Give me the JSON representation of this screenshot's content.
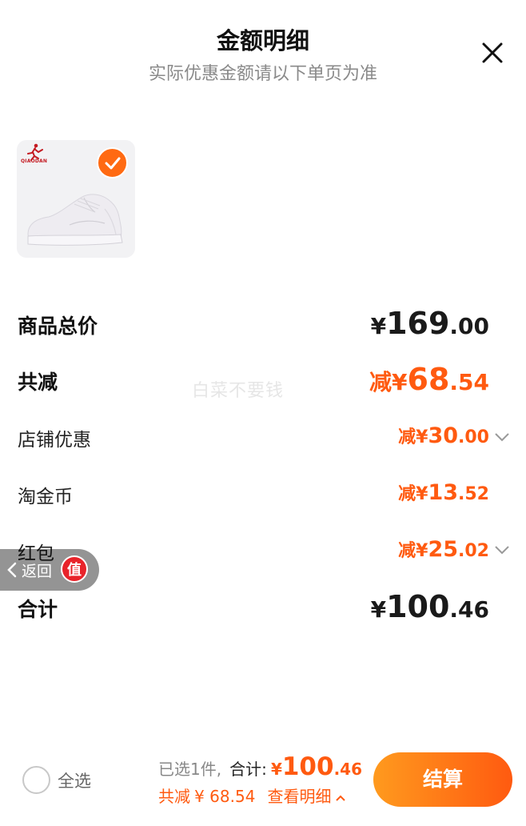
{
  "header": {
    "title": "金额明细",
    "subtitle": "实际优惠金额请以下单页为准"
  },
  "product": {
    "brand_text": "QIAODAN"
  },
  "rows": {
    "total_price": {
      "label": "商品总价",
      "yen": "¥",
      "int": "169",
      "dec": ".00"
    },
    "total_discount": {
      "label": "共减",
      "minus": "减",
      "yen": "¥",
      "int": "68",
      "dec": ".54"
    },
    "shop_discount": {
      "label": "店铺优惠",
      "minus": "减",
      "yen": "¥",
      "int": "30",
      "dec": ".00"
    },
    "taojinbi": {
      "label": "淘金币",
      "minus": "减",
      "yen": "¥",
      "int": "13",
      "dec": ".52"
    },
    "red_packet": {
      "label": "红包",
      "minus": "减",
      "yen": "¥",
      "int": "25",
      "dec": ".02"
    },
    "sum": {
      "label": "合计",
      "yen": "¥",
      "int": "100",
      "dec": ".46"
    }
  },
  "watermark": "白菜不要钱",
  "back_pill": {
    "label": "返回",
    "badge": "值"
  },
  "bottom": {
    "select_all": "全选",
    "selected_count": "已选1件,",
    "total_label": "合计:",
    "total_yen": "¥",
    "total_int": "100",
    "total_dec": ".46",
    "discount_label": "共减",
    "discount_value": "¥ 68.54",
    "view_detail": "查看明细",
    "checkout": "结算"
  },
  "colors": {
    "accent": "#ff5a10",
    "accent_gradient_start": "#ff9a1e",
    "check": "#ff6a12"
  }
}
